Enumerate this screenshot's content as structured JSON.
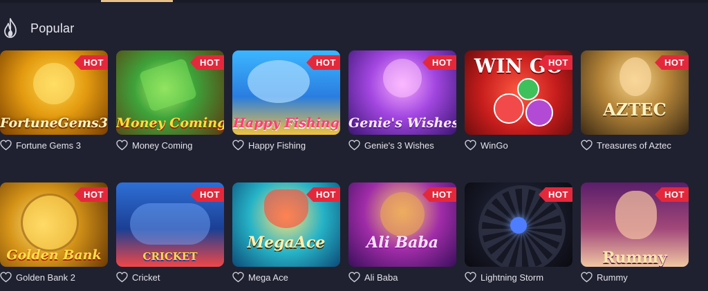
{
  "section": {
    "icon": "flame-icon",
    "title": "Popular"
  },
  "badge_label": "HOT",
  "games": [
    {
      "name": "Fortune Gems 3",
      "art_text": "FortuneGems3",
      "hot": true
    },
    {
      "name": "Money Coming",
      "art_text": "Money Coming",
      "hot": true
    },
    {
      "name": "Happy Fishing",
      "art_text": "Happy Fishing",
      "hot": true
    },
    {
      "name": "Genie's 3 Wishes",
      "art_text": "Genie's Wishes",
      "hot": true
    },
    {
      "name": "WinGo",
      "art_text": "WIN GO",
      "hot": true
    },
    {
      "name": "Treasures of Aztec",
      "art_text": "AZTEC",
      "hot": true
    },
    {
      "name": "Golden Bank 2",
      "art_text": "Golden Bank",
      "hot": true
    },
    {
      "name": "Cricket",
      "art_text": "CRICKET",
      "hot": true
    },
    {
      "name": "Mega Ace",
      "art_text": "MegaAce",
      "hot": true
    },
    {
      "name": "Ali Baba",
      "art_text": "Ali Baba",
      "hot": true
    },
    {
      "name": "Lightning Storm",
      "art_text": "",
      "hot": true
    },
    {
      "name": "Rummy",
      "art_text": "Rummy",
      "hot": true
    }
  ],
  "colors": {
    "background": "#1f2130",
    "hot_badge": "#e4283c",
    "tab_indicator": "#e8c08a"
  }
}
